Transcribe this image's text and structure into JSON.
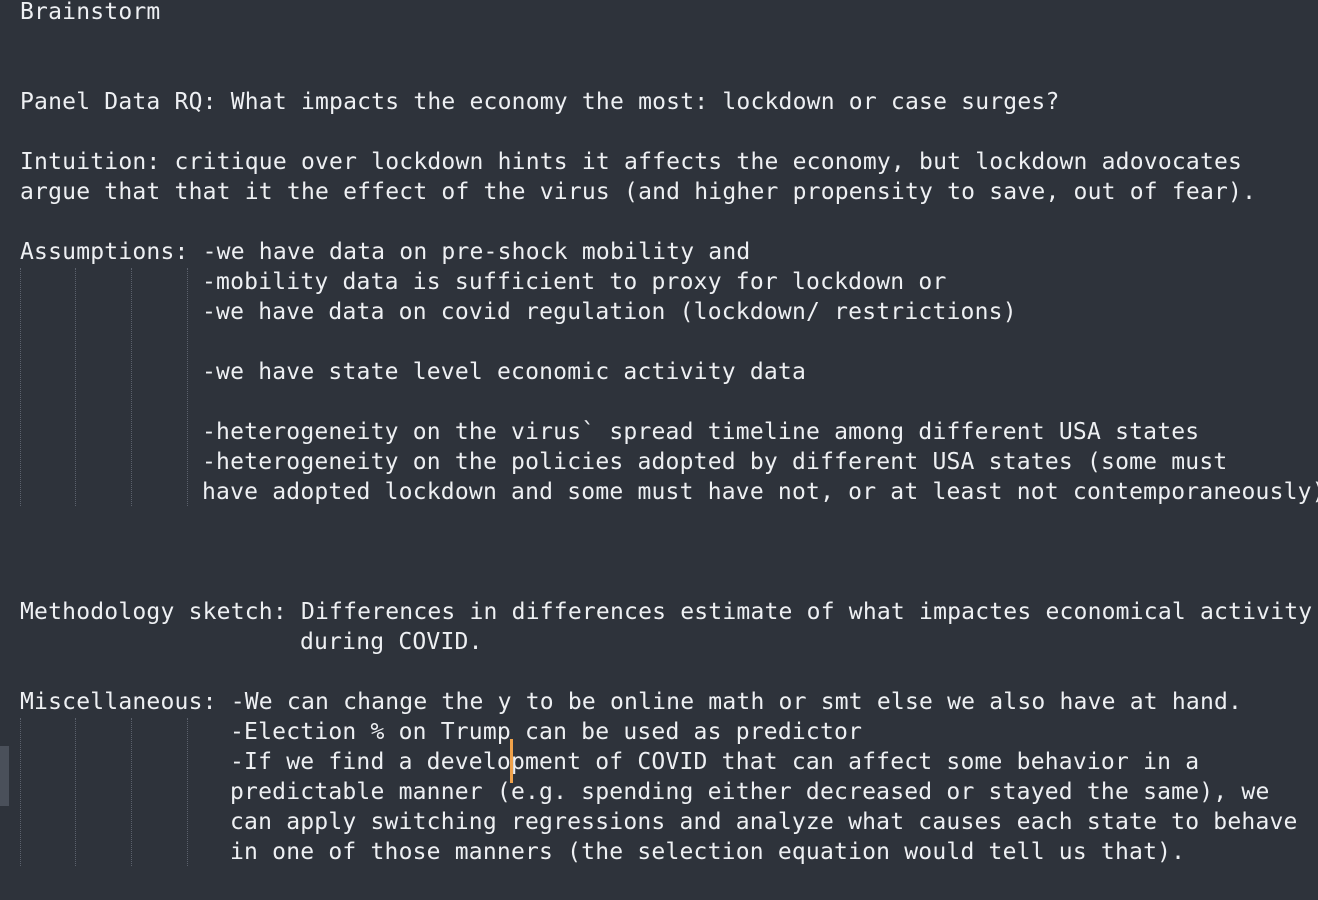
{
  "document": {
    "lines": [
      "Brainstorm",
      "Panel Data RQ: What impacts the economy the most: lockdown or case surges?",
      "Intuition: critique over lockdown hints it affects the economy, but lockdown adovocates",
      "argue that that it the effect of the virus (and higher propensity to save, out of fear).",
      "Assumptions: -we have data on pre-shock mobility and",
      "-mobility data is sufficient to proxy for lockdown or",
      "-we have data on covid regulation (lockdown/ restrictions)",
      "-we have state level economic activity data",
      "-heterogeneity on the virus` spread timeline among different USA states",
      "-heterogeneity on the policies adopted by different USA states (some must",
      "have adopted lockdown and some must have not, or at least not contemporaneously)",
      "Methodology sketch: Differences in differences estimate of what impactes economical activity",
      "during COVID.",
      "Miscellaneous: -We can change the y to be online math or smt else we also have at hand.",
      "-Election % on Trump can be used as predictor",
      "-If we find a development of COVID that can affect some behavior in a",
      "predictable manner (e.g. spending either decreased or stayed the same), we",
      "can apply switching regressions and analyze what causes each state to behave",
      "in one of those manners (the selection equation would tell us that)."
    ]
  },
  "colors": {
    "background": "#2e333b",
    "text": "#eef0f3",
    "caret": "#f0a24a",
    "indent_guide": "#5b616c"
  }
}
